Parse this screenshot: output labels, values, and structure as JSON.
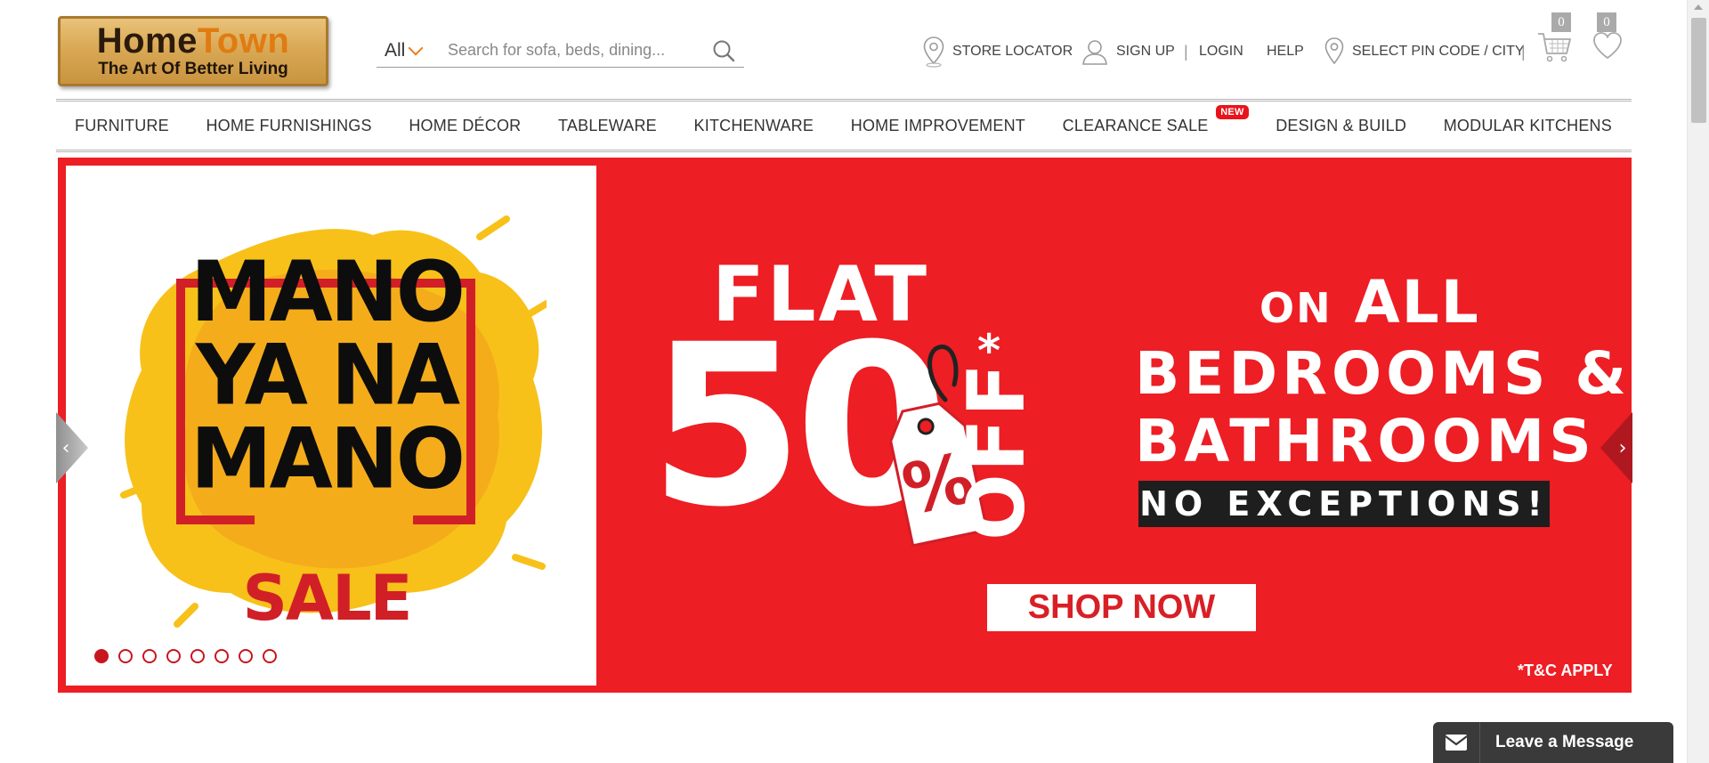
{
  "header": {
    "logo": {
      "brand_home": "Home",
      "brand_town": "Town",
      "tagline": "The Art Of Better Living"
    },
    "search": {
      "category": "All",
      "placeholder": "Search for sofa, beds, dining..."
    },
    "nav": {
      "store_locator": "STORE LOCATOR",
      "sign_up": "SIGN UP",
      "separator": "|",
      "login": "LOGIN",
      "help": "HELP",
      "pin_code": "SELECT PIN CODE / CITY"
    },
    "cart_count": "0",
    "wishlist_count": "0"
  },
  "categories": [
    {
      "label": "FURNITURE"
    },
    {
      "label": "HOME FURNISHINGS"
    },
    {
      "label": "HOME DÉCOR"
    },
    {
      "label": "TABLEWARE"
    },
    {
      "label": "KITCHENWARE"
    },
    {
      "label": "HOME IMPROVEMENT"
    },
    {
      "label": "CLEARANCE SALE",
      "tag": "NEW"
    },
    {
      "label": "DESIGN & BUILD"
    },
    {
      "label": "MODULAR KITCHENS"
    }
  ],
  "banner": {
    "sale_lines": [
      "MANO",
      "YA NA",
      "MANO"
    ],
    "sale_word": "SALE",
    "flat": "FLAT",
    "discount": "50",
    "percent": "%",
    "off": "OFF",
    "star": "*",
    "on": "ON",
    "all": "ALL",
    "line1": "BEDROOMS &",
    "line2": "BATHROOMS",
    "no_exceptions": "NO EXCEPTIONS!",
    "cta": "SHOP NOW",
    "terms": "*T&C APPLY",
    "slides_total": 8,
    "active_slide": 1,
    "prev_glyph": "‹",
    "next_glyph": "›"
  },
  "chat": {
    "label": "Leave a Message"
  },
  "colors": {
    "accent_orange": "#ef7d1a",
    "banner_red": "#ed1e24",
    "sale_yellow": "#f7c11a",
    "new_tag_red": "#e8141c"
  }
}
